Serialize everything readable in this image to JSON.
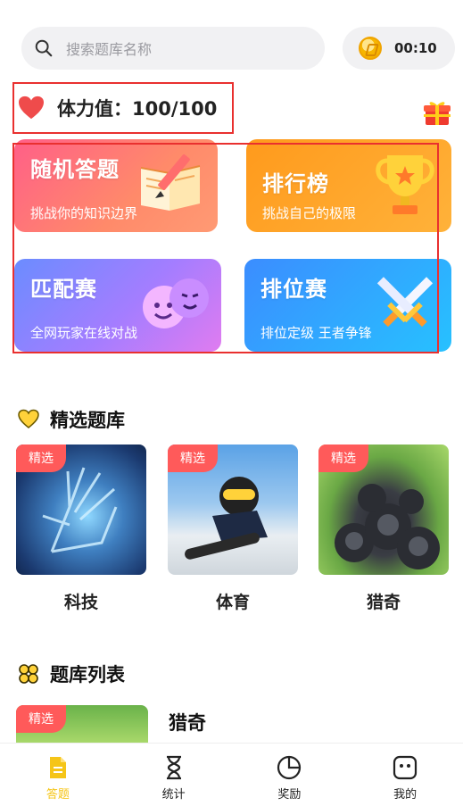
{
  "search": {
    "placeholder": "搜索题库名称"
  },
  "timer": {
    "value": "00:10"
  },
  "stamina": {
    "label": "体力值：100/100"
  },
  "features": [
    {
      "title": "随机答题",
      "subtitle": "挑战你的知识边界"
    },
    {
      "title": "排行榜",
      "subtitle": "挑战自己的极限"
    },
    {
      "title": "匹配赛",
      "subtitle": "全网玩家在线对战"
    },
    {
      "title": "排位赛",
      "subtitle": "排位定级 王者争锋"
    }
  ],
  "featured": {
    "heading": "精选题库",
    "items": [
      {
        "badge": "精选",
        "name": "科技"
      },
      {
        "badge": "精选",
        "name": "体育"
      },
      {
        "badge": "精选",
        "name": "猎奇"
      }
    ]
  },
  "bank_list": {
    "heading": "题库列表",
    "items": [
      {
        "badge": "精选",
        "name": "猎奇"
      }
    ]
  },
  "tabs": [
    {
      "label": "答题",
      "icon": "document-icon",
      "active": true
    },
    {
      "label": "统计",
      "icon": "hourglass-icon",
      "active": false
    },
    {
      "label": "奖励",
      "icon": "pie-chart-icon",
      "active": false
    },
    {
      "label": "我的",
      "icon": "face-icon",
      "active": false
    }
  ],
  "colors": {
    "accent": "#f5c518",
    "highlight_box": "#e9302f",
    "badge": "#ff5a5a"
  }
}
